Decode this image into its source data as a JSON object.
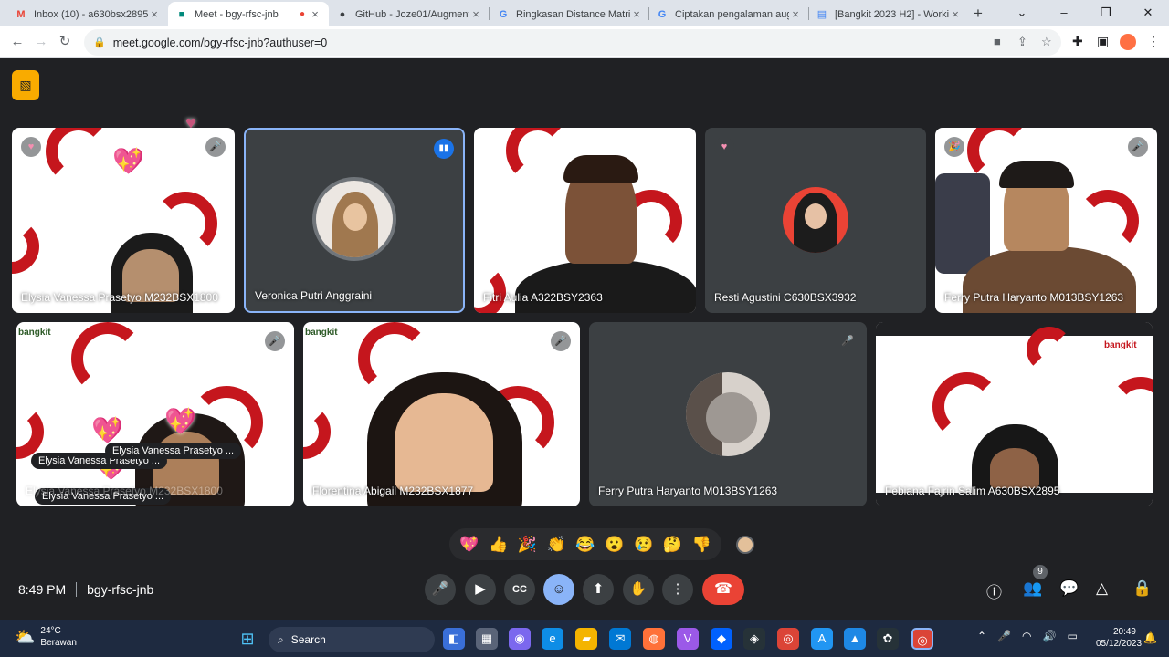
{
  "browser": {
    "tabs": [
      {
        "title": "Inbox (10) - a630bsx2895@...",
        "icon": "gmail-icon"
      },
      {
        "title": "Meet - bgy-rfsc-jnb",
        "icon": "meet-icon",
        "active": true
      },
      {
        "title": "GitHub - Joze01/Augment...",
        "icon": "github-icon"
      },
      {
        "title": "Ringkasan Distance Matrix ...",
        "icon": "google-icon"
      },
      {
        "title": "Ciptakan pengalaman aug...",
        "icon": "google-icon"
      },
      {
        "title": "[Bangkit 2023 H2] - Worki...",
        "icon": "docs-icon"
      }
    ],
    "url": "meet.google.com/bgy-rfsc-jnb?authuser=0"
  },
  "tiles": [
    {
      "name": "Elysia Vanessa Prasetyo M232BSX1800"
    },
    {
      "name": "Veronica Putri Anggraini"
    },
    {
      "name": "Fitri Aulia A322BSY2363"
    },
    {
      "name": "Resti Agustini C630BSX3932"
    },
    {
      "name": "Ferry Putra Haryanto M013BSY1263"
    },
    {
      "name": "Elysia Vanessa Prasetyo M232BSX1800"
    },
    {
      "name": "Florentina Abigail M232BSX1877"
    },
    {
      "name": "Ferry Putra Haryanto M013BSY1263"
    },
    {
      "name": "Febiana Fajrin Salim A630BSX2895"
    }
  ],
  "reaction_labels": [
    "Elysia Vanessa Prasetyo ...",
    "Elysia Vanessa Prasetyo ...",
    "Elysia Vanessa Prasetyo ..."
  ],
  "bangkit_logo": "bangkit",
  "reactions": [
    "💖",
    "👍",
    "🎉",
    "👏",
    "😂",
    "😮",
    "😢",
    "🤔",
    "👎"
  ],
  "meeting": {
    "time": "8:49 PM",
    "code": "bgy-rfsc-jnb",
    "participants": "9"
  },
  "taskbar": {
    "temp": "24°C",
    "weather": "Berawan",
    "search": "Search",
    "time": "20:49",
    "date": "05/12/2023"
  },
  "colors": {
    "accent": "#8ab4f8",
    "end_call": "#ea4335",
    "meet_bg": "#202124",
    "bangkit_red": "#c5161d"
  }
}
